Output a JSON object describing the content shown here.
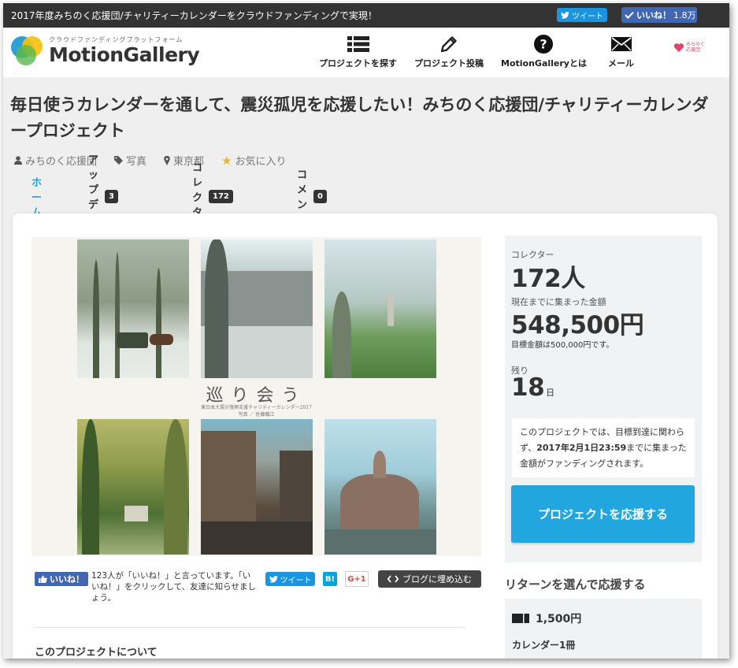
{
  "topbar": {
    "title": "2017年度みちのく応援団/チャリティーカレンダーをクラウドファンディングで実現！",
    "tweet_label": "ツイート",
    "like_label": "いいね！",
    "like_count": "1.8万"
  },
  "header": {
    "logo_sub": "クラウドファンディングプラットフォーム",
    "logo_name": "MotionGallery",
    "nav": [
      {
        "label": "プロジェクトを探す",
        "icon": "list-icon"
      },
      {
        "label": "プロジェクト投稿",
        "icon": "pencil-icon"
      },
      {
        "label": "MotionGalleryとは",
        "icon": "question-icon"
      },
      {
        "label": "メール",
        "icon": "mail-icon"
      }
    ],
    "partner_logo_text": "みちのく応援団"
  },
  "project": {
    "title": "毎日使うカレンダーを通して、震災孤児を応援したい！みちのく応援団/チャリティーカレンダープロジェクト",
    "owner": "みちのく応援団",
    "category": "写真",
    "location": "東京都",
    "favorite": "お気に入り"
  },
  "tabs": [
    {
      "label": "ホーム",
      "count": null
    },
    {
      "label": "アップデート",
      "count": "3"
    },
    {
      "label": "コレクター",
      "count": "172"
    },
    {
      "label": "コメント",
      "count": "0"
    }
  ],
  "image": {
    "title": "巡り会う",
    "subtitle_line1": "東日本大震災復興支援チャリティーカレンダー2017",
    "subtitle_line2": "写真 ／ 佐藤織江"
  },
  "share": {
    "fb_like": "いいね！",
    "fb_text": "123人が「いいね！」と言っています。「いいね！」をクリックして、友達に知らせましょう。",
    "tweet": "ツイート",
    "hatena": "B!",
    "gplus": "G+1",
    "embed": "ブログに埋め込む"
  },
  "about_heading": "このプロジェクトについて",
  "sidebar": {
    "collectors_label": "コレクター",
    "collectors_value": "172人",
    "amount_label": "現在までに集まった金額",
    "amount_value": "548,500円",
    "goal_text": "目標金額は500,000円です。",
    "remaining_label": "残り",
    "remaining_value": "18",
    "remaining_unit": "日",
    "notice_pre": "このプロジェクトでは、目標到達に関わらず、",
    "notice_bold": "2017年2月1日23:59",
    "notice_post": "までに集まった金額がファンディングされます。",
    "cta": "プロジェクトを応援する",
    "returns_heading": "リターンを選んで応援する",
    "return_price": "1,500円",
    "return_name": "カレンダー1冊"
  },
  "colors": {
    "accent": "#22a6df",
    "topbar": "#333333",
    "facebook": "#4267b2",
    "twitter": "#1b95e0"
  }
}
